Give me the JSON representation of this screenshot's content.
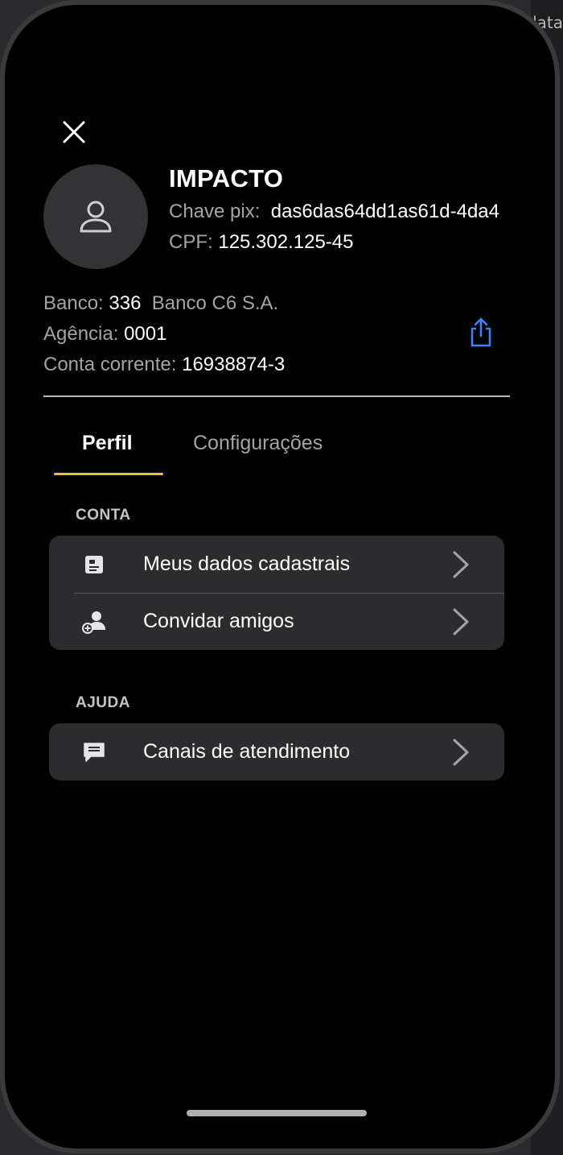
{
  "background_peek": {
    "text": "lata"
  },
  "header": {
    "close_icon": "close-icon",
    "avatar_icon": "person-icon",
    "name": "IMPACTO",
    "pix_label": "Chave pix:",
    "pix_value": "das6das64dd1as61d-4da4",
    "cpf_label": "CPF:",
    "cpf_value": "125.302.125-45"
  },
  "bank": {
    "banco_label": "Banco:",
    "banco_code": "336",
    "banco_name": "Banco C6 S.A.",
    "agencia_label": "Agência:",
    "agencia_value": "0001",
    "conta_label": "Conta corrente:",
    "conta_value": "16938874-3",
    "share_icon": "share-icon"
  },
  "tabs": [
    {
      "label": "Perfil",
      "active": true
    },
    {
      "label": "Configurações",
      "active": false
    }
  ],
  "sections": [
    {
      "title": "CONTA",
      "items": [
        {
          "label": "Meus dados cadastrais",
          "icon": "id-card-icon"
        },
        {
          "label": "Convidar amigos",
          "icon": "add-person-icon"
        }
      ]
    },
    {
      "title": "AJUDA",
      "items": [
        {
          "label": "Canais de atendimento",
          "icon": "chat-bubble-icon"
        }
      ]
    }
  ],
  "colors": {
    "accent_underline": "#f5b94a",
    "share_icon": "#3b82f6",
    "card_bg": "#2c2c2e",
    "screen_bg": "#000000"
  }
}
